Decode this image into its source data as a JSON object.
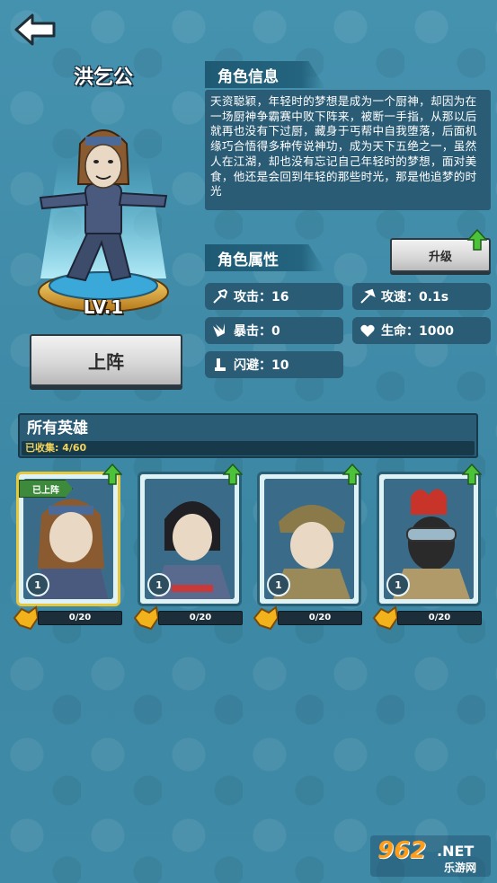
{
  "hero": {
    "name": "洪乞公",
    "level": "LV.1"
  },
  "buttons": {
    "deploy": "上阵",
    "upgrade": "升级"
  },
  "sections": {
    "info": "角色信息",
    "attributes": "角色属性"
  },
  "description": "天资聪颖，年轻时的梦想是成为一个厨神，却因为在一场厨神争霸赛中败下阵来，被断一手指，从那以后就再也没有下过厨，藏身于丐帮中自我堕落，后面机缘巧合悟得多种传说神功，成为天下五绝之一，虽然人在江湖，却也没有忘记自己年轻时的梦想，面对美食，他还是会回到年轻的那些时光，那是他追梦的时光",
  "stats": [
    {
      "label": "攻击：16",
      "icon": "attack-icon"
    },
    {
      "label": "攻速：0.1s",
      "icon": "attack-speed-icon"
    },
    {
      "label": "暴击：0",
      "icon": "crit-icon"
    },
    {
      "label": "生命：1000",
      "icon": "heart-icon"
    },
    {
      "label": "闪避：10",
      "icon": "dodge-icon"
    }
  ],
  "heroes": {
    "title": "所有英雄",
    "collected": "已收集: 4/60",
    "deployed_tag": "已上阵",
    "cards": [
      {
        "level": "1",
        "fragments": "0/20",
        "selected": true
      },
      {
        "level": "1",
        "fragments": "0/20",
        "selected": false
      },
      {
        "level": "1",
        "fragments": "0/20",
        "selected": false
      },
      {
        "level": "1",
        "fragments": "0/20",
        "selected": false
      }
    ]
  },
  "watermark": {
    "main": "962",
    "suffix": ".NET",
    "sub": "乐游网"
  },
  "colors": {
    "background": "#3f8aa6",
    "panel": "#2b5c75",
    "upgrade_arrow": "#4cc23a",
    "fragment_icon": "#f2b21c",
    "selected_border": "#e6c83a"
  }
}
